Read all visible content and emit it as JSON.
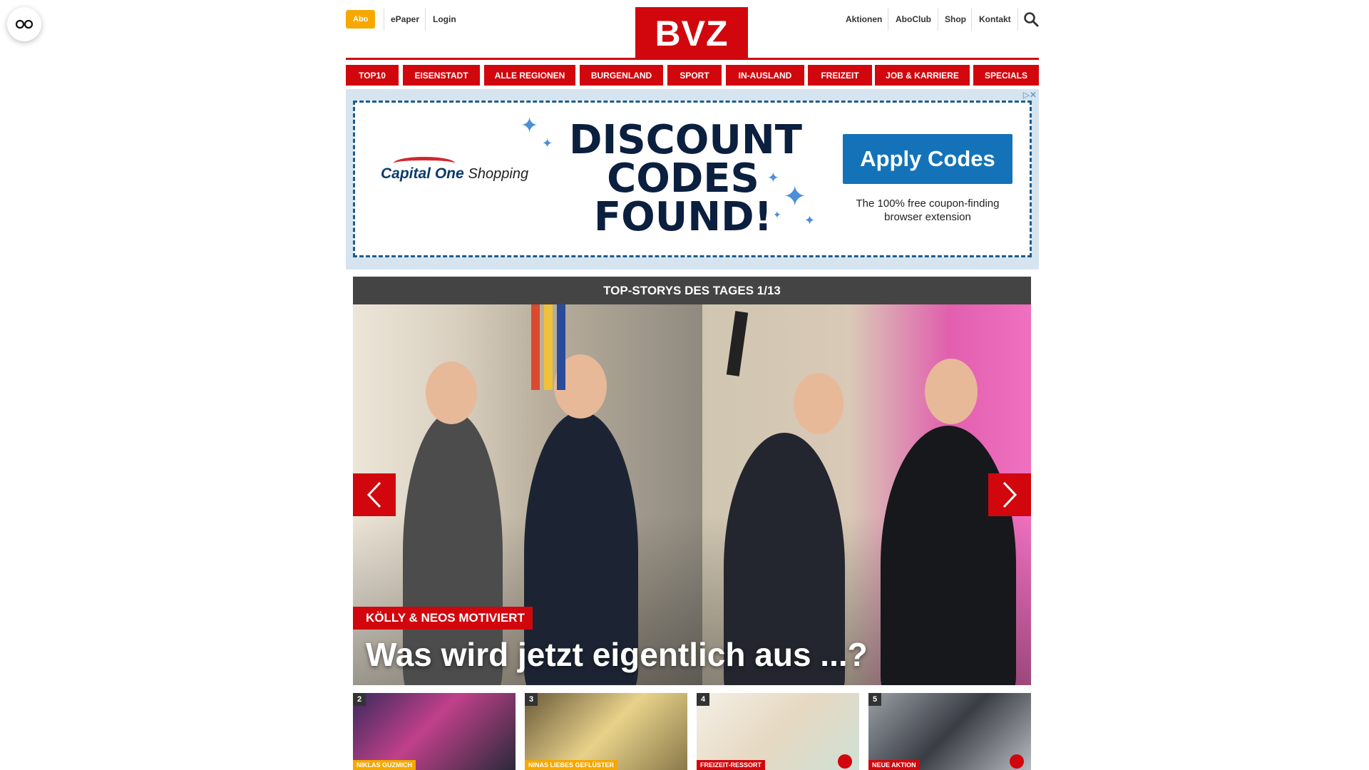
{
  "header": {
    "abo": "Abo",
    "left_links": [
      "ePaper",
      "Login"
    ],
    "logo": "BVZ",
    "right_links": [
      "Aktionen",
      "AboClub",
      "Shop",
      "Kontakt"
    ]
  },
  "nav": [
    "TOP10",
    "EISENSTADT",
    "ALLE REGIONEN",
    "BURGENLAND",
    "SPORT",
    "IN-AUSLAND",
    "FREIZEIT",
    "JOB & KARRIERE",
    "SPECIALS"
  ],
  "ad": {
    "brand": "Capital One",
    "brand_suffix": "Shopping",
    "headline_lines": [
      "DISCOUNT",
      "CODES",
      "FOUND!"
    ],
    "cta": "Apply Codes",
    "subtext": "The 100% free coupon-finding browser extension"
  },
  "top_stories": {
    "header": "TOP-STORYS DES TAGES 1/13",
    "kicker": "KÖLLY & NEOS MOTIVIERT",
    "title": "Was wird jetzt eigentlich aus ...?"
  },
  "thumbs": [
    {
      "num": "2",
      "tag": "NIKLAS GUZMICH"
    },
    {
      "num": "3",
      "tag": "NINAS LIEBES GEFLÜSTER"
    },
    {
      "num": "4",
      "tag": "FREIZEIT-RESSORT"
    },
    {
      "num": "5",
      "tag": "NEUE AKTION"
    }
  ],
  "colors": {
    "brand_red": "#d1070d",
    "abo_orange": "#f5a800",
    "ad_blue": "#1473b8",
    "story_header": "#444444"
  }
}
